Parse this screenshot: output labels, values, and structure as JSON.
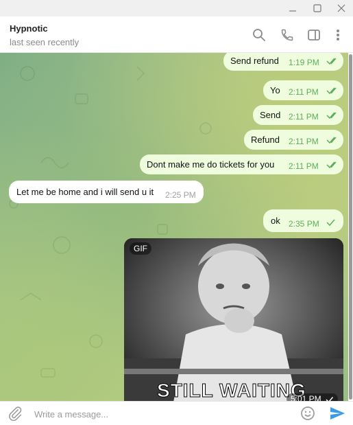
{
  "window": {
    "minimize_icon": "minimize-icon",
    "maximize_icon": "maximize-icon",
    "close_icon": "close-icon"
  },
  "header": {
    "name": "Hypnotic",
    "status": "last seen recently",
    "icons": [
      "search-icon",
      "phone-icon",
      "sidebar-icon",
      "more-vertical-icon"
    ]
  },
  "messages": [
    {
      "type": "out",
      "text": "Send refund",
      "time": "1:19 PM",
      "status": "read"
    },
    {
      "type": "out",
      "text": "Yo",
      "time": "2:11 PM",
      "status": "read"
    },
    {
      "type": "out",
      "text": "Send",
      "time": "2:11 PM",
      "status": "read"
    },
    {
      "type": "out",
      "text": "Refund",
      "time": "2:11 PM",
      "status": "read"
    },
    {
      "type": "out",
      "text": "Dont make me do tickets for you",
      "time": "2:11 PM",
      "status": "read"
    },
    {
      "type": "in",
      "text": "Let me be home and i will send u it",
      "time": "2:25 PM"
    },
    {
      "type": "out",
      "text": "ok",
      "time": "2:35 PM",
      "status": "sent"
    }
  ],
  "gif": {
    "badge": "GIF",
    "caption": "STILL WAITING",
    "time": "5:01 PM",
    "status": "sent"
  },
  "composer": {
    "placeholder": "Write a message...",
    "icons": [
      "attach-icon",
      "emoji-icon",
      "send-icon"
    ]
  },
  "colors": {
    "outgoing_bubble": "#effdde",
    "incoming_bubble": "#ffffff",
    "accent": "#3a9be8",
    "tick_green": "#5eae5c"
  }
}
